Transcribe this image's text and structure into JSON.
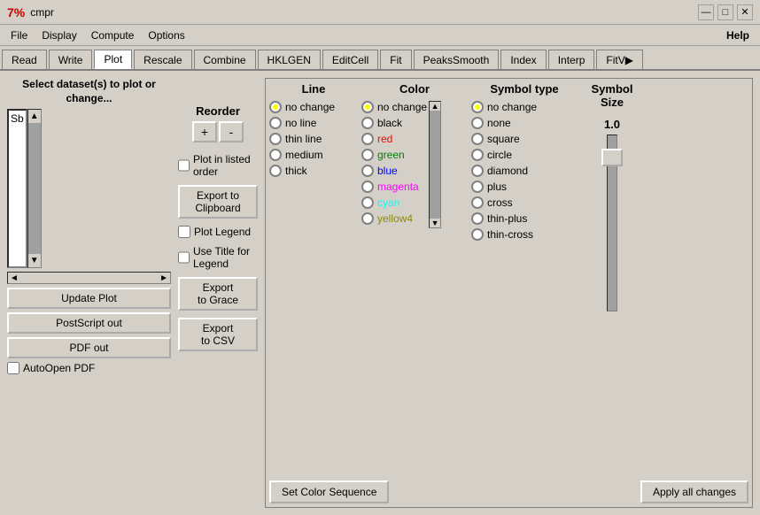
{
  "titlebar": {
    "icon": "7%",
    "title": "cmpr",
    "minimize": "—",
    "restore": "□",
    "close": "✕"
  },
  "menubar": {
    "items": [
      "File",
      "Display",
      "Compute",
      "Options"
    ],
    "help": "Help"
  },
  "tabs": {
    "items": [
      "Read",
      "Write",
      "Plot",
      "Rescale",
      "Combine",
      "HKLGEN",
      "EditCell",
      "Fit",
      "PeaksSmooth",
      "Index",
      "Interp",
      "FitV▶"
    ],
    "active": "Plot"
  },
  "left": {
    "label": "Select dataset(s) to plot or change...",
    "dataset_value": "Sb",
    "checkboxes": {
      "plot_order": "Plot in listed order",
      "plot_legend": "Plot Legend",
      "use_title": "Use Title for Legend",
      "auto_open": "AutoOpen PDF"
    },
    "buttons": {
      "update": "Update Plot",
      "postscript": "PostScript out",
      "pdf": "PDF out",
      "export_clipboard": "Export to\nClipboard",
      "export_grace": "Export\nto Grace",
      "export_csv": "Export\nto CSV"
    }
  },
  "reorder": {
    "label": "Reorder",
    "plus": "+",
    "minus": "-"
  },
  "line": {
    "header": "Line",
    "options": [
      "no change",
      "no line",
      "thin line",
      "medium",
      "thick"
    ],
    "selected": "no change"
  },
  "color": {
    "header": "Color",
    "options": [
      {
        "label": "no change",
        "color": "black"
      },
      {
        "label": "black",
        "color": "black"
      },
      {
        "label": "red",
        "color": "red"
      },
      {
        "label": "green",
        "color": "green"
      },
      {
        "label": "blue",
        "color": "blue"
      },
      {
        "label": "magenta",
        "color": "magenta"
      },
      {
        "label": "cyan",
        "color": "cyan"
      },
      {
        "label": "yellow4",
        "color": "#8b8b00"
      }
    ],
    "selected": "no change"
  },
  "symbol_type": {
    "header": "Symbol type",
    "options": [
      "no change",
      "none",
      "square",
      "circle",
      "diamond",
      "plus",
      "cross",
      "thin-plus",
      "thin-cross"
    ],
    "selected": "no change"
  },
  "symbol_size": {
    "header": "Symbol Size",
    "value": "1.0"
  },
  "bottom": {
    "set_color": "Set Color Sequence",
    "apply": "Apply all changes"
  }
}
